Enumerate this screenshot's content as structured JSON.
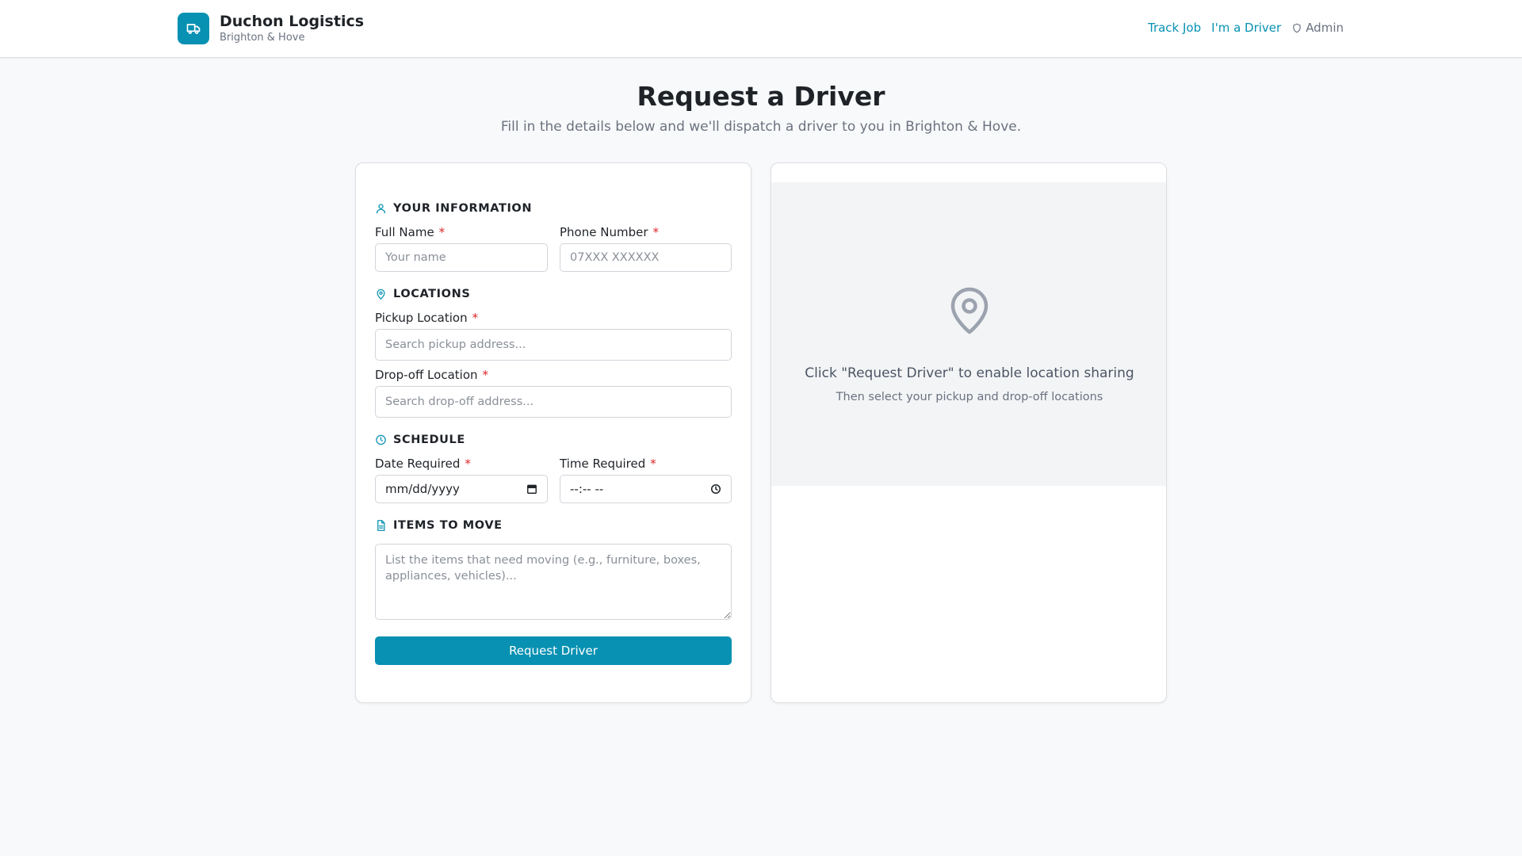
{
  "header": {
    "brand_name": "Duchon Logistics",
    "brand_sub": "Brighton & Hove",
    "nav": {
      "track_job": "Track Job",
      "driver": "I'm a Driver",
      "admin": "Admin"
    }
  },
  "page": {
    "title": "Request a Driver",
    "subtitle": "Fill in the details below and we'll dispatch a driver to you in Brighton & Hove."
  },
  "form": {
    "your_info": {
      "heading": "YOUR INFORMATION",
      "full_name_label": "Full Name",
      "full_name_placeholder": "Your name",
      "phone_label": "Phone Number",
      "phone_placeholder": "07XXX XXXXXX"
    },
    "locations": {
      "heading": "LOCATIONS",
      "pickup_label": "Pickup Location",
      "pickup_placeholder": "Search pickup address...",
      "dropoff_label": "Drop-off Location",
      "dropoff_placeholder": "Search drop-off address..."
    },
    "schedule": {
      "heading": "SCHEDULE",
      "date_label": "Date Required",
      "date_value": "mm/dd/yyyy",
      "time_label": "Time Required",
      "time_value": "--:-- --"
    },
    "items": {
      "heading": "ITEMS TO MOVE",
      "placeholder": "List the items that need moving (e.g., furniture, boxes, appliances, vehicles)..."
    },
    "required_marker": "*",
    "submit_label": "Request Driver"
  },
  "map": {
    "message": "Click \"Request Driver\" to enable location sharing",
    "sub": "Then select your pickup and drop-off locations"
  },
  "colors": {
    "accent": "#0891b2",
    "required": "#dc2626",
    "background": "#f8f9fa"
  },
  "icons": {
    "logo": "truck-icon",
    "admin": "shield-icon",
    "your_info": "user-icon",
    "locations": "map-pin-icon",
    "schedule": "clock-icon",
    "items": "document-icon",
    "date": "calendar-icon",
    "time": "clock-icon",
    "map_placeholder": "map-pin-icon"
  }
}
